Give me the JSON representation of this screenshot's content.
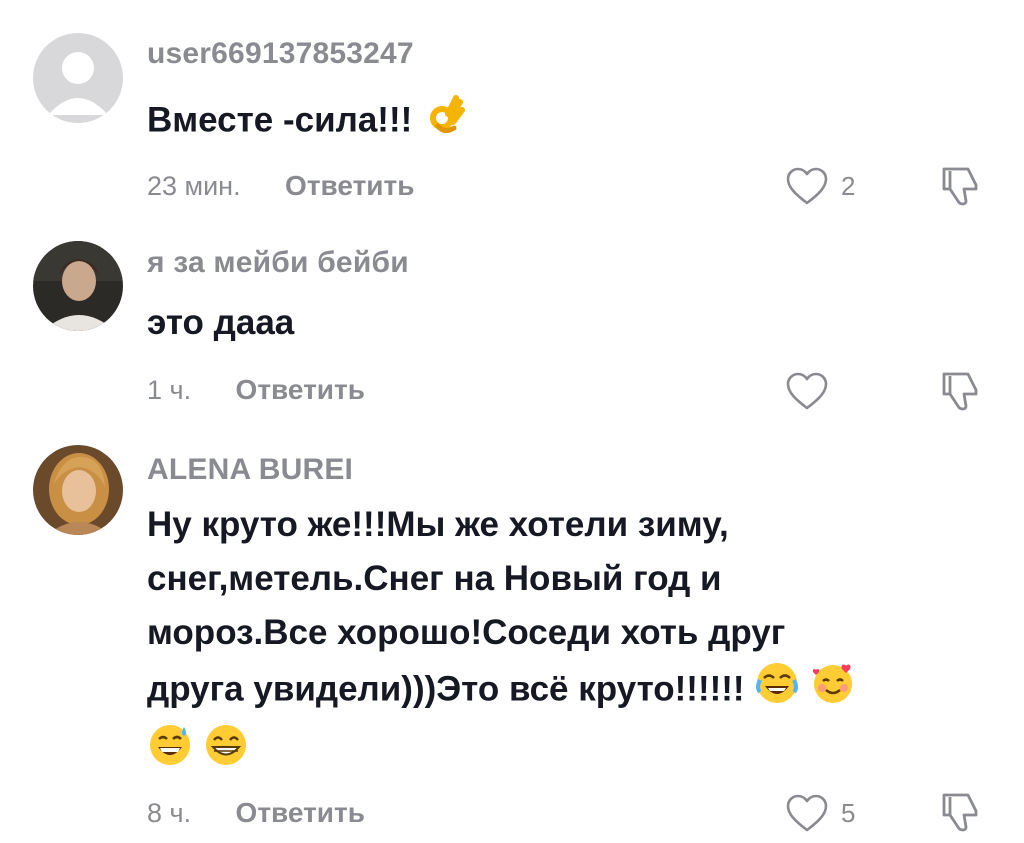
{
  "comments": [
    {
      "username": "user669137853247",
      "text_lines": [
        "Вместе -сила!!!"
      ],
      "emojis_line0": [
        "ok-hand-emoji"
      ],
      "time": "23 мин.",
      "reply_label": "Ответить",
      "like_count": "2"
    },
    {
      "username": "я за мейби бейби",
      "text_lines": [
        "это дааа"
      ],
      "time": "1 ч.",
      "reply_label": "Ответить",
      "like_count": ""
    },
    {
      "username": "ALENA BUREI",
      "text_lines": [
        "Ну круто же!!!Мы же хотели зиму,",
        "снег,метель.Снег на Новый год и",
        "мороз.Все хорошо!Соседи хоть друг",
        "друга увидели)))Это всё круто!!!!!!"
      ],
      "emojis_line3": [
        "tears-of-joy-emoji",
        "smiling-face-with-hearts-emoji"
      ],
      "emojis_line4": [
        "grinning-sweat-emoji",
        "beaming-grin-emoji"
      ],
      "time": "8 ч.",
      "reply_label": "Ответить",
      "like_count": "5"
    }
  ],
  "colors": {
    "primary_text": "#161823",
    "secondary_text": "#8a8b91",
    "background": "#ffffff"
  }
}
